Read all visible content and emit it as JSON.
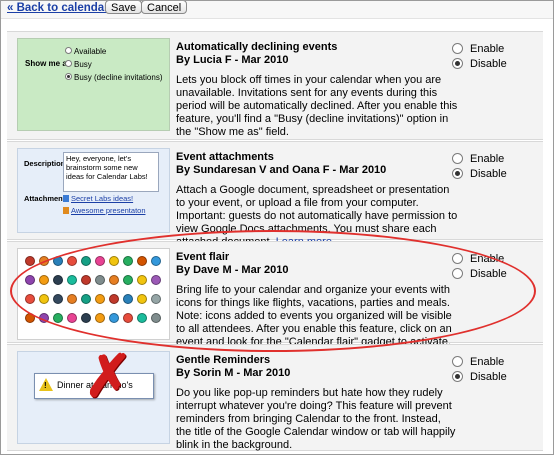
{
  "toolbar": {
    "back_label": "« Back to calendar",
    "save_label": "Save",
    "cancel_label": "Cancel"
  },
  "options": {
    "enable": "Enable",
    "disable": "Disable"
  },
  "features": [
    {
      "title": "Automatically declining events",
      "byline": "By Lucia F - Mar 2010",
      "description": "Lets you block off times in your calendar when you are unavailable. Invitations sent for any events during this period will be automatically declined. After you enable this feature, you'll find a \"Busy (decline invitations)\" option in the \"Show me as\" field.",
      "selected": "disable",
      "preview": {
        "label": "Show me as",
        "options": [
          "Available",
          "Busy",
          "Busy (decline invitations)"
        ],
        "selected_index": 2
      }
    },
    {
      "title": "Event attachments",
      "byline": "By Sundaresan V and Oana F - Mar 2010",
      "description": "Attach a Google document, spreadsheet or presentation to your event, or upload a file from your computer. Important: guests do not automatically have permission to view Google Docs attachments. You must share each attached document.",
      "learn_more": "Learn more",
      "selected": "disable",
      "preview": {
        "description_label": "Description",
        "description_text": "Hey, everyone, let's brainstorm some new ideas for Calendar Labs!",
        "attachment_label": "Attachment",
        "attachments": [
          "Secret Labs ideas!",
          "Awesome presentaton"
        ]
      }
    },
    {
      "title": "Event flair",
      "byline": "By Dave M - Mar 2010",
      "description": "Bring life to your calendar and organize your events with icons for things like flights, vacations, parties and meals. Note: icons added to events you organized will be visible to all attendees. After you enable this feature, click on an event and look for the \"Calendar flair\" gadget to activate.",
      "selected": "disable",
      "preview": {
        "icon_colors": [
          "#c0392b",
          "#e67e22",
          "#2980b9",
          "#e74c3c",
          "#16a085",
          "#e84393",
          "#f1c40f",
          "#27ae60",
          "#d35400",
          "#3498db",
          "#8e44ad",
          "#f39c12",
          "#2c3e50",
          "#1abc9c",
          "#c0392b",
          "#7f8c8d",
          "#e67e22",
          "#27ae60",
          "#f1c40f",
          "#9b59b6",
          "#e74c3c",
          "#f1c40f",
          "#34495e",
          "#e67e22",
          "#16a085",
          "#f39c12",
          "#c0392b",
          "#2980b9",
          "#f1c40f",
          "#95a5a6",
          "#d35400",
          "#8e44ad",
          "#27ae60",
          "#e84393",
          "#2c3e50",
          "#f39c12",
          "#3498db",
          "#e74c3c",
          "#1abc9c",
          "#7f8c8d"
        ]
      }
    },
    {
      "title": "Gentle Reminders",
      "byline": "By Sorin M - Mar 2010",
      "description": "Do you like pop-up reminders but hate how they rudely interrupt whatever you're doing? This feature will prevent reminders from bringing Calendar to the front. Instead, the title of the Google Calendar window or tab will happily blink in the background.",
      "selected": "disable",
      "preview": {
        "popup_text": "Dinner at Pancho's",
        "warning_mark": "!"
      }
    }
  ]
}
